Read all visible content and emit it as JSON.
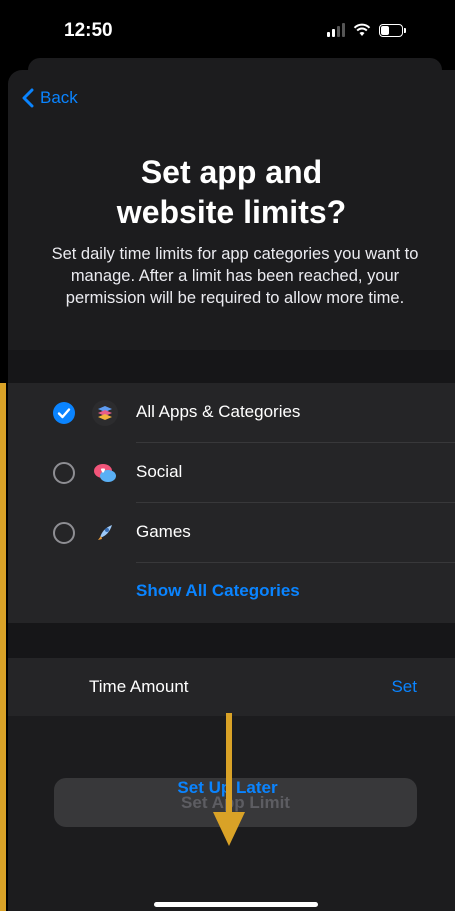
{
  "status_bar": {
    "time": "12:50",
    "icons": [
      "signal-icon",
      "wifi-icon",
      "battery-icon"
    ]
  },
  "nav": {
    "back_label": "Back"
  },
  "header": {
    "title_line1": "Set app and",
    "title_line2": "website limits?",
    "description": "Set daily time limits for app categories you want to manage. After a limit has been reached, your permission will be required to allow more time."
  },
  "categories": [
    {
      "label": "All Apps & Categories",
      "checked": true,
      "icon": "stack-icon"
    },
    {
      "label": "Social",
      "checked": false,
      "icon": "chat-bubbles-icon"
    },
    {
      "label": "Games",
      "checked": false,
      "icon": "rocket-icon"
    }
  ],
  "show_all_label": "Show All Categories",
  "time_amount": {
    "label": "Time Amount",
    "action": "Set"
  },
  "buttons": {
    "set_limit": "Set App Limit",
    "set_up_later": "Set Up Later"
  },
  "colors": {
    "accent": "#0a84ff",
    "annotation": "#d9a227",
    "sheet": "#1c1c1e"
  }
}
